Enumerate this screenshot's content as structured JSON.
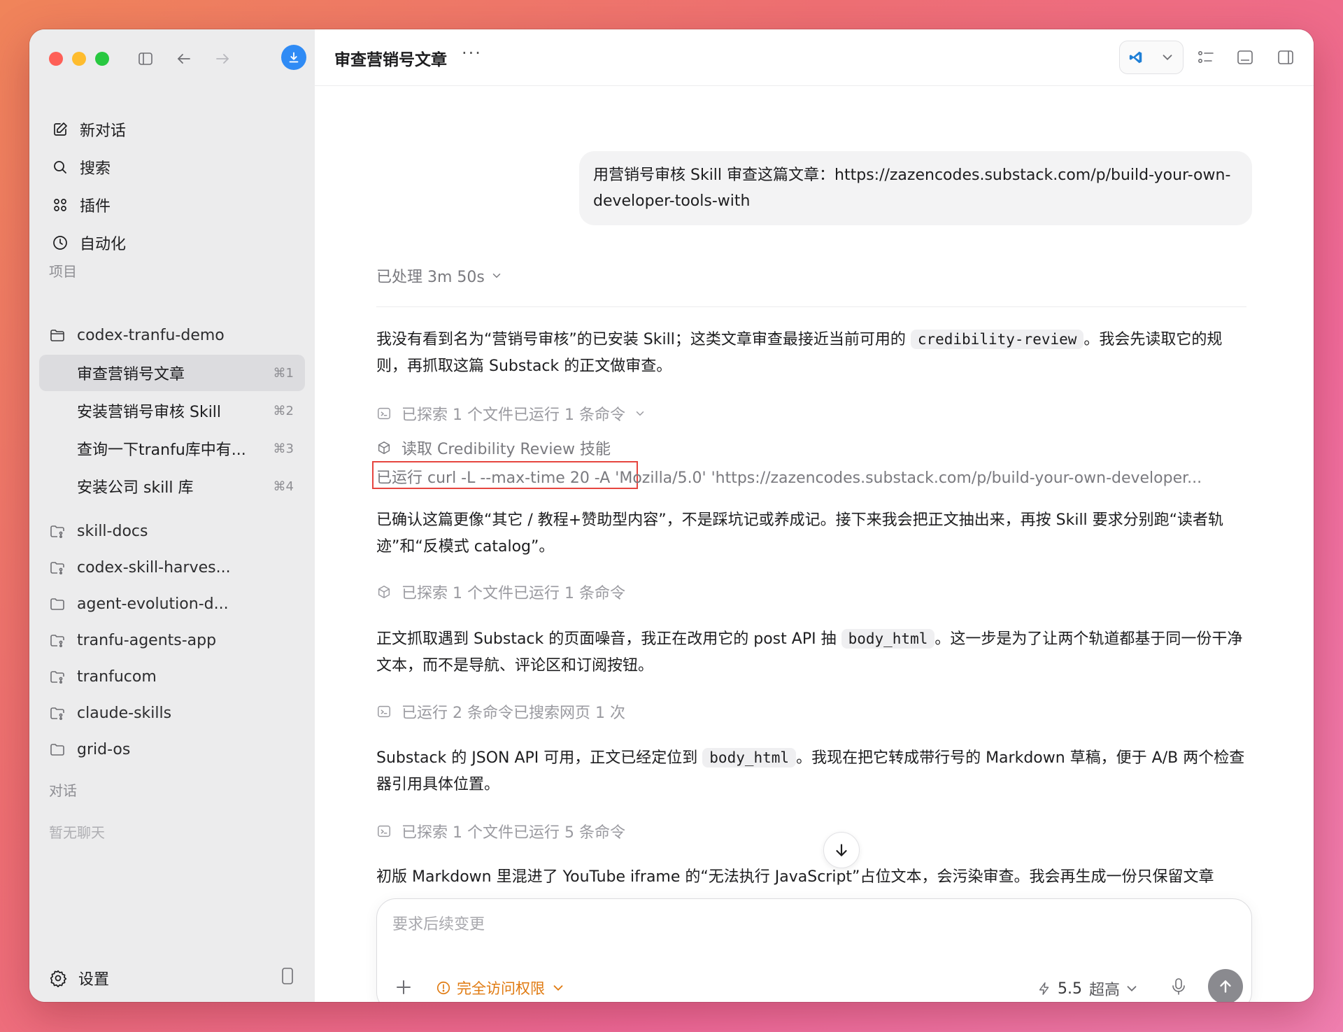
{
  "sidebar": {
    "nav": [
      {
        "label": "新对话",
        "icon": "edit-icon"
      },
      {
        "label": "搜索",
        "icon": "search-icon"
      },
      {
        "label": "插件",
        "icon": "plugin-grid-icon"
      },
      {
        "label": "自动化",
        "icon": "clock-icon"
      }
    ],
    "projects_label": "项目",
    "active_project": "codex-tranfu-demo",
    "threads": [
      {
        "label": "审查营销号文章",
        "shortcut": "⌘1",
        "active": true
      },
      {
        "label": "安装营销号审核 Skill",
        "shortcut": "⌘2"
      },
      {
        "label": "查询一下tranfu库中有...",
        "shortcut": "⌘3"
      },
      {
        "label": "安装公司 skill 库",
        "shortcut": "⌘4"
      }
    ],
    "other_projects": [
      "skill-docs",
      "codex-skill-harves...",
      "agent-evolution-d...",
      "tranfu-agents-app",
      "tranfucom",
      "claude-skills",
      "grid-os"
    ],
    "chats_label": "对话",
    "no_chats": "暂无聊天",
    "settings_label": "设置"
  },
  "header": {
    "title": "审查营销号文章",
    "more": "···"
  },
  "conversation": {
    "user_message": "用营销号审核 Skill 审查这篇文章：https://zazencodes.substack.com/p/build-your-own-developer-tools-with",
    "processed": "已处理 3m 50s",
    "p1_a": "我没有看到名为“营销号审核”的已安装 Skill；这类文章审查最接近当前可用的 ",
    "p1_code": "credibility-review",
    "p1_b": "。我会先读取它的规则，再抓取这篇 Substack 的正文做审查。",
    "step1": "已探索 1 个文件已运行 1 条命令",
    "step_skill": "读取 Credibility Review 技能",
    "run_line": "已运行 curl -L --max-time 20 -A 'Mozilla/5.0' 'https://zazencodes.substack.com/p/build-your-own-developer...",
    "p2": "已确认这篇更像“其它 / 教程+赞助型内容”，不是踩坑记或养成记。接下来我会把正文抽出来，再按 Skill 要求分别跑“读者轨迹”和“反模式 catalog”。",
    "step2": "已探索 1 个文件已运行 1 条命令",
    "p3_a": "正文抓取遇到 Substack 的页面噪音，我正在改用它的 post API 抽 ",
    "p3_code": "body_html",
    "p3_b": "。这一步是为了让两个轨道都基于同一份干净文本，而不是导航、评论区和订阅按钮。",
    "step3": "已运行 2 条命令已搜索网页 1 次",
    "p4_a": "Substack 的 JSON API 可用，正文已经定位到 ",
    "p4_code": "body_html",
    "p4_b": "。我现在把它转成带行号的 Markdown 草稿，便于 A/B 两个检查器引用具体位置。",
    "step4": "已探索 1 个文件已运行 5 条命令",
    "p5": "初版 Markdown 里混进了 YouTube iframe 的“无法执行 JavaScript”占位文本，会污染审查。我会再生成一份只保留文章"
  },
  "composer": {
    "placeholder": "要求后续变更",
    "permission": "完全访问权限",
    "model_version": "5.5",
    "model_level": "超高"
  },
  "colors": {
    "accent_blue": "#2f8bf5",
    "highlight_red": "#e6453f",
    "permission_orange": "#e07a10"
  }
}
